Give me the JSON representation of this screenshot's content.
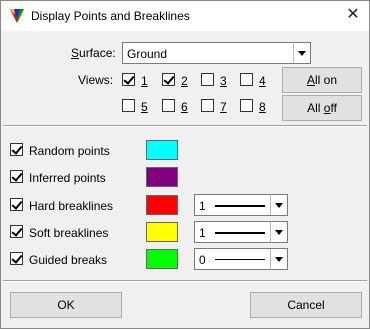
{
  "window": {
    "title": "Display Points and Breaklines",
    "close_icon": "close-icon"
  },
  "surface": {
    "label": "Surface:",
    "value": "Ground"
  },
  "views": {
    "label": "Views:",
    "items": [
      {
        "label": "1",
        "checked": true
      },
      {
        "label": "2",
        "checked": true
      },
      {
        "label": "3",
        "checked": false
      },
      {
        "label": "4",
        "checked": false
      },
      {
        "label": "5",
        "checked": false
      },
      {
        "label": "6",
        "checked": false
      },
      {
        "label": "7",
        "checked": false
      },
      {
        "label": "8",
        "checked": false
      }
    ],
    "all_on_label": "All on",
    "all_off_label": "All off"
  },
  "options": [
    {
      "label": "Random points",
      "checked": true,
      "color": "#00ffff"
    },
    {
      "label": "Inferred points",
      "checked": true,
      "color": "#800080"
    },
    {
      "label": "Hard breaklines",
      "checked": true,
      "color": "#ff0000",
      "weight": "1"
    },
    {
      "label": "Soft breaklines",
      "checked": true,
      "color": "#ffff00",
      "weight": "1"
    },
    {
      "label": "Guided breaks",
      "checked": true,
      "color": "#00ff00",
      "weight": "0"
    }
  ],
  "buttons": {
    "ok_label": "OK",
    "cancel_label": "Cancel"
  }
}
